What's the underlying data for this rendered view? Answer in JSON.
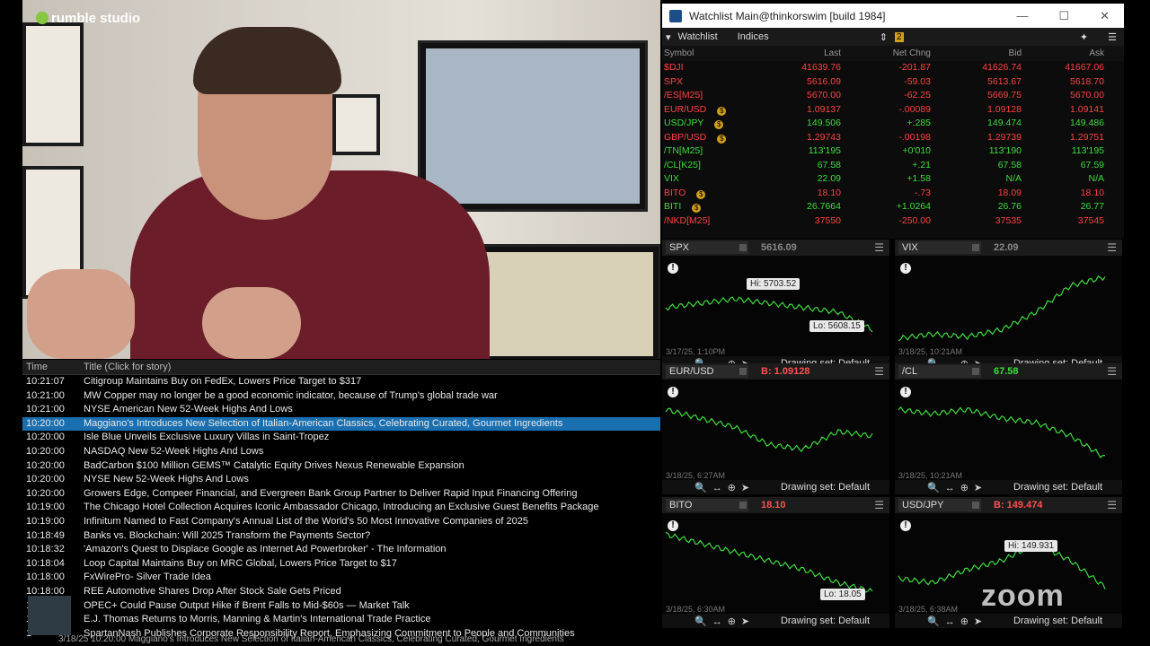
{
  "video": {
    "brand": "rumble studio",
    "overlay": "zoom"
  },
  "news": {
    "col_time": "Time",
    "col_title": "Title (Click for story)",
    "rows": [
      {
        "time": "10:21:07",
        "title": "Citigroup Maintains Buy on FedEx, Lowers Price Target to $317"
      },
      {
        "time": "10:21:00",
        "title": "MW Copper may no longer be a good economic indicator, because of Trump's global trade war"
      },
      {
        "time": "10:21:00",
        "title": "NYSE American New 52-Week Highs And Lows"
      },
      {
        "time": "10:20:00",
        "title": "Maggiano's Introduces New Selection of Italian-American Classics, Celebrating Curated, Gourmet Ingredients",
        "selected": true
      },
      {
        "time": "10:20:00",
        "title": "Isle Blue Unveils Exclusive Luxury Villas in Saint-Tropez"
      },
      {
        "time": "10:20:00",
        "title": "NASDAQ New 52-Week Highs And Lows"
      },
      {
        "time": "10:20:00",
        "title": "BadCarbon $100 Million GEMS™ Catalytic Equity Drives Nexus Renewable Expansion"
      },
      {
        "time": "10:20:00",
        "title": "NYSE New 52-Week Highs And Lows"
      },
      {
        "time": "10:20:00",
        "title": "Growers Edge, Compeer Financial, and Evergreen Bank Group Partner to Deliver Rapid Input Financing Offering"
      },
      {
        "time": "10:19:00",
        "title": "The Chicago Hotel Collection Acquires Iconic Ambassador Chicago, Introducing an Exclusive Guest Benefits Package"
      },
      {
        "time": "10:19:00",
        "title": "Infinitum Named to Fast Company's Annual List of the World's 50 Most Innovative Companies of 2025"
      },
      {
        "time": "10:18:49",
        "title": "Banks vs. Blockchain: Will 2025 Transform the Payments Sector?"
      },
      {
        "time": "10:18:32",
        "title": "'Amazon's Quest to Displace Google as Internet Ad Powerbroker' - The Information"
      },
      {
        "time": "10:18:04",
        "title": "Loop Capital Maintains Buy on MRC Global, Lowers Price Target to $17"
      },
      {
        "time": "10:18:00",
        "title": "FxWirePro- Silver Trade Idea"
      },
      {
        "time": "10:18:00",
        "title": "REE Automotive Shares Drop After Stock Sale Gets Priced"
      },
      {
        "time": "1",
        "title": "OPEC+ Could Pause Output Hike if Brent Falls to Mid-$60s — Market Talk"
      },
      {
        "time": "1",
        "title": "E.J. Thomas Returns to Morris, Manning & Martin's International Trade Practice"
      },
      {
        "time": "1",
        "title": "SpartanNash Publishes Corporate Responsibility Report, Emphasizing Commitment to People and Communities"
      }
    ],
    "status": "3/18/25 10:20:00  Maggiano's Introduces New Selection of Italian-American Classics, Celebrating Curated, Gourmet Ingredients"
  },
  "watchlist": {
    "window_title": "Watchlist Main@thinkorswim [build 1984]",
    "tab_label": "Watchlist",
    "list_name": "Indices",
    "link_badge": "2",
    "headers": [
      "Symbol",
      "Last",
      "Net Chng",
      "Bid",
      "Ask"
    ],
    "rows": [
      {
        "sym": "$DJI",
        "last": "41639.76",
        "chg": "-201.87",
        "bid": "41626.74",
        "ask": "41667.06",
        "color": "red"
      },
      {
        "sym": "SPX",
        "last": "5616.09",
        "chg": "-59.03",
        "bid": "5613.67",
        "ask": "5618.70",
        "color": "red"
      },
      {
        "sym": "/ES[M25]",
        "last": "5670.00",
        "chg": "-62.25",
        "bid": "5669.75",
        "ask": "5670.00",
        "color": "red"
      },
      {
        "sym": "EUR/USD",
        "last": "1.09137",
        "chg": "-.00089",
        "bid": "1.09128",
        "ask": "1.09141",
        "color": "red",
        "badge": true
      },
      {
        "sym": "USD/JPY",
        "last": "149.506",
        "chg": "+.285",
        "bid": "149.474",
        "ask": "149.486",
        "color": "green",
        "badge": true
      },
      {
        "sym": "GBP/USD",
        "last": "1.29743",
        "chg": "-.00198",
        "bid": "1.29739",
        "ask": "1.29751",
        "color": "red",
        "badge": true
      },
      {
        "sym": "/TN[M25]",
        "last": "113'195",
        "chg": "+0'010",
        "bid": "113'190",
        "ask": "113'195",
        "color": "green"
      },
      {
        "sym": "/CL[K25]",
        "last": "67.58",
        "chg": "+.21",
        "bid": "67.58",
        "ask": "67.59",
        "color": "green"
      },
      {
        "sym": "VIX",
        "last": "22.09",
        "chg": "+1.58",
        "bid": "N/A",
        "ask": "N/A",
        "color": "green"
      },
      {
        "sym": "BITO",
        "last": "18.10",
        "chg": "-.73",
        "bid": "18.09",
        "ask": "18.10",
        "color": "red",
        "badge": true
      },
      {
        "sym": "BITI",
        "last": "26.7664",
        "chg": "+1.0264",
        "bid": "26.76",
        "ask": "26.77",
        "color": "green",
        "badge": true
      },
      {
        "sym": "/NKD[M25]",
        "last": "37550",
        "chg": "-250.00",
        "bid": "37535",
        "ask": "37545",
        "color": "red"
      }
    ]
  },
  "charts": [
    {
      "symbol": "SPX",
      "price": "5616.09",
      "price_color": "#888888",
      "hi": "Hi: 5703.52",
      "lo": "Lo: 5608.15",
      "date": "3/17/25, 1:10PM",
      "drawing_set": "Drawing set: Default"
    },
    {
      "symbol": "VIX",
      "price": "22.09",
      "price_color": "#888888",
      "hi": "",
      "lo": "",
      "date": "3/18/25, 10:21AM",
      "drawing_set": "Drawing set: Default"
    },
    {
      "symbol": "EUR/USD",
      "price": "B: 1.09128",
      "price_color": "#ff5050",
      "hi": "",
      "lo": "",
      "date": "3/18/25, 6:27AM",
      "drawing_set": "Drawing set: Default"
    },
    {
      "symbol": "/CL",
      "price": "67.58",
      "price_color": "#3ddc3d",
      "hi": "",
      "lo": "",
      "date": "3/18/25, 10:21AM",
      "drawing_set": "Drawing set: Default"
    },
    {
      "symbol": "BITO",
      "price": "18.10",
      "price_color": "#ff5050",
      "hi": "",
      "lo": "Lo: 18.05",
      "date": "3/18/25, 6:30AM",
      "drawing_set": "Drawing set: Default"
    },
    {
      "symbol": "USD/JPY",
      "price": "B: 149.474",
      "price_color": "#ff5050",
      "hi": "Hi: 149.931",
      "lo": "",
      "date": "3/18/25, 6:38AM",
      "drawing_set": "Drawing set: Default"
    }
  ],
  "colors": {
    "up": "#3ddc3d",
    "down": "#ff4040",
    "selection": "#1a6fb0"
  }
}
